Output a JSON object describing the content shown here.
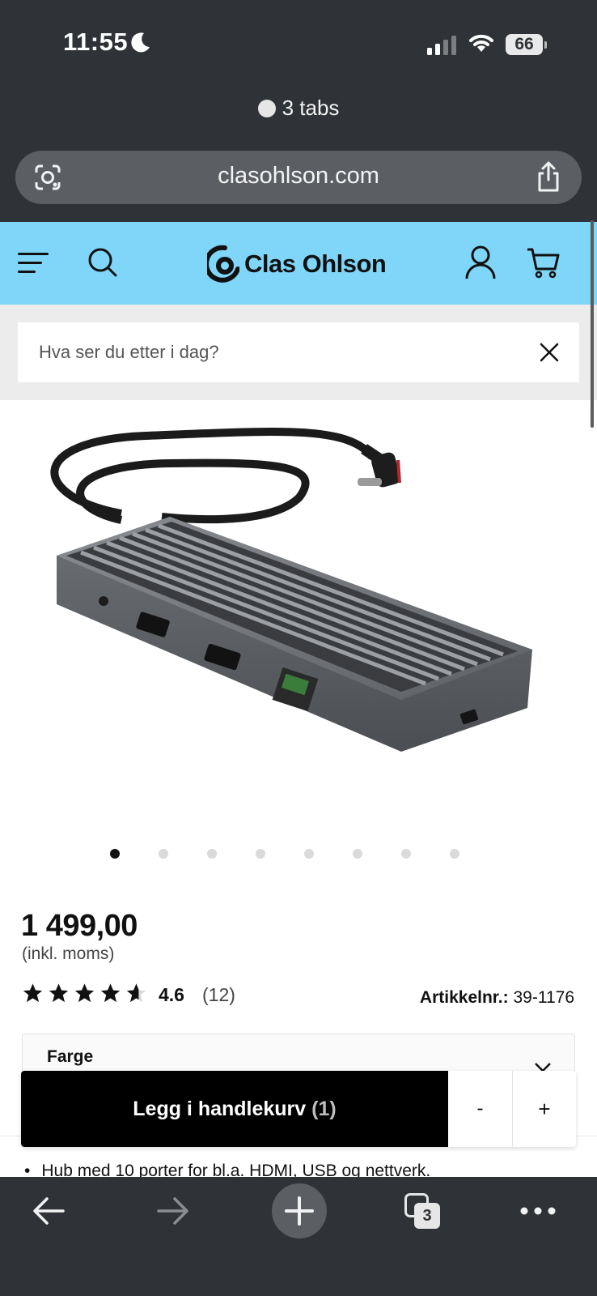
{
  "status_bar": {
    "time": "11:55",
    "battery": "66"
  },
  "browser": {
    "tabs_label": "3 tabs",
    "url": "clasohlson.com",
    "tab_count": "3"
  },
  "site": {
    "brand": "Clas Ohlson",
    "brand_color": "#7fd6f8",
    "search_placeholder": "Hva ser du etter i dag?"
  },
  "gallery": {
    "image_count": 8,
    "active_index": 0
  },
  "product": {
    "price": "1 499,00",
    "vat_note": "(inkl. moms)",
    "rating_value": "4.6",
    "rating_stars": 4.6,
    "review_count": "(12)",
    "article_label": "Artikkelnr.:",
    "article_number": "39-1176",
    "color_label": "Farge",
    "bullet": "Hub med 10 porter for bl.a. HDMI, USB og nettverk."
  },
  "cart_bar": {
    "add_label": "Legg i handlekurv",
    "quantity": "(1)",
    "minus": "-",
    "plus": "+"
  }
}
